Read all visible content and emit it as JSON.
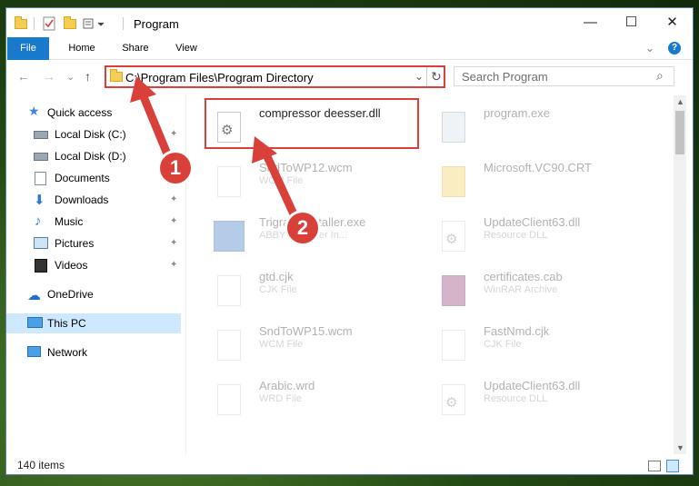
{
  "window": {
    "title": "Program",
    "minimize_glyph": "—",
    "maximize_glyph": "☐",
    "close_glyph": "✕"
  },
  "ribbon": {
    "tabs": [
      {
        "label": "File",
        "active": true
      },
      {
        "label": "Home"
      },
      {
        "label": "Share"
      },
      {
        "label": "View"
      }
    ],
    "help_glyph": "?",
    "expand_glyph": "⌄"
  },
  "navigation": {
    "back_glyph": "←",
    "forward_glyph": "→",
    "recent_glyph": "⌄",
    "up_glyph": "↑",
    "address": "C:\\Program Files\\Program Directory",
    "refresh_glyph": "↻",
    "dropdown_glyph": "⌄",
    "search_placeholder": "Search Program",
    "search_glyph": "⌕"
  },
  "sidebar": {
    "items": [
      {
        "label": "Quick access",
        "icon": "star-icon"
      },
      {
        "label": "Local Disk (C:)",
        "icon": "drive-icon",
        "pinned": true
      },
      {
        "label": "Local Disk (D:)",
        "icon": "drive-icon",
        "pinned": true
      },
      {
        "label": "Documents",
        "icon": "documents-icon",
        "pinned": true
      },
      {
        "label": "Downloads",
        "icon": "downloads-icon",
        "pinned": true
      },
      {
        "label": "Music",
        "icon": "music-icon",
        "pinned": true
      },
      {
        "label": "Pictures",
        "icon": "pictures-icon",
        "pinned": true
      },
      {
        "label": "Videos",
        "icon": "videos-icon",
        "pinned": true
      },
      {
        "label": "OneDrive",
        "icon": "onedrive-icon"
      },
      {
        "label": "This PC",
        "icon": "this-pc-icon",
        "selected": true
      },
      {
        "label": "Network",
        "icon": "network-icon"
      }
    ],
    "pin_glyph": "📌"
  },
  "files": [
    {
      "name": "compressor deesser.dll",
      "type": "",
      "icon": "dll-icon",
      "highlighted": true
    },
    {
      "name": "program.exe",
      "type": "",
      "icon": "exe-icon"
    },
    {
      "name": "SndToWP12.wcm",
      "type": "WCM File",
      "icon": "file-icon"
    },
    {
      "name": "Microsoft.VC90.CRT",
      "type": "",
      "icon": "folder-icon"
    },
    {
      "name": "TrigraphInstaller.exe",
      "type": "ABBYY Reader In...",
      "icon": "installer-icon"
    },
    {
      "name": "UpdateClient63.dll",
      "type": "Resource DLL",
      "icon": "dll-icon"
    },
    {
      "name": "gtd.cjk",
      "type": "CJK File",
      "icon": "file-icon"
    },
    {
      "name": "certificates.cab",
      "type": "WinRAR Archive",
      "icon": "archive-icon"
    },
    {
      "name": "SndToWP15.wcm",
      "type": "WCM File",
      "icon": "file-icon"
    },
    {
      "name": "FastNmd.cjk",
      "type": "CJK File",
      "icon": "file-icon"
    },
    {
      "name": "Arabic.wrd",
      "type": "WRD File",
      "icon": "file-icon"
    },
    {
      "name": "UpdateClient63.dll",
      "type": "Resource DLL",
      "icon": "dll-icon"
    }
  ],
  "status": {
    "item_count": "140 items"
  },
  "annotations": {
    "step1": "1",
    "step2": "2",
    "accent": "#d9403a"
  }
}
